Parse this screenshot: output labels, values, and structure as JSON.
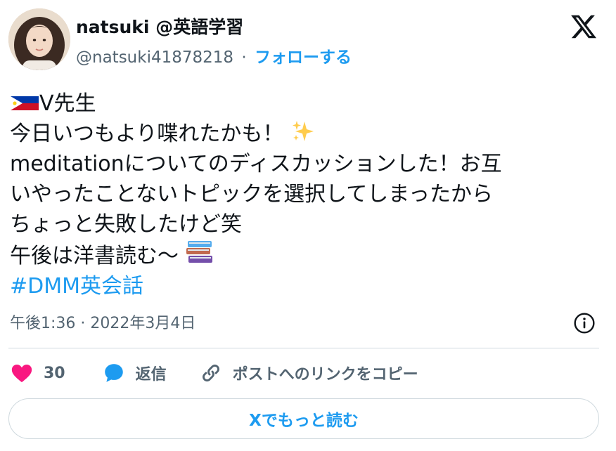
{
  "author": {
    "display_name": "natsuki @英語学習",
    "handle": "@natsuki41878218",
    "separator": "·",
    "follow_label": "フォローする",
    "avatar": "avatar-photo"
  },
  "brand": {
    "logo": "x-logo-icon"
  },
  "tweet": {
    "lines": [
      {
        "text": "V先生",
        "leading_emoji": "philippines-flag-icon"
      },
      {
        "text": "今日いつもより喋れたかも！",
        "trailing_emoji": "sparkles-icon"
      },
      {
        "text": "meditationについてのディスカッションした！お互"
      },
      {
        "text": "いやったことないトピックを選択してしまったから"
      },
      {
        "text": "ちょっと失敗したけど笑"
      },
      {
        "text": "午後は洋書読む〜",
        "trailing_emoji": "books-icon"
      }
    ],
    "hashtag": "#DMM英会話"
  },
  "meta": {
    "time": "午後1:36",
    "separator": "·",
    "date": "2022年3月4日",
    "info_icon": "info-icon"
  },
  "actions": {
    "like_count": "30",
    "reply_label": "返信",
    "copy_link_label": "ポストへのリンクをコピー"
  },
  "read_more_label": "Xでもっと読む",
  "colors": {
    "accent": "#1d9bf0",
    "like": "#f91880",
    "text": "#0f1419",
    "muted": "#536471",
    "border": "#cfd9de"
  }
}
